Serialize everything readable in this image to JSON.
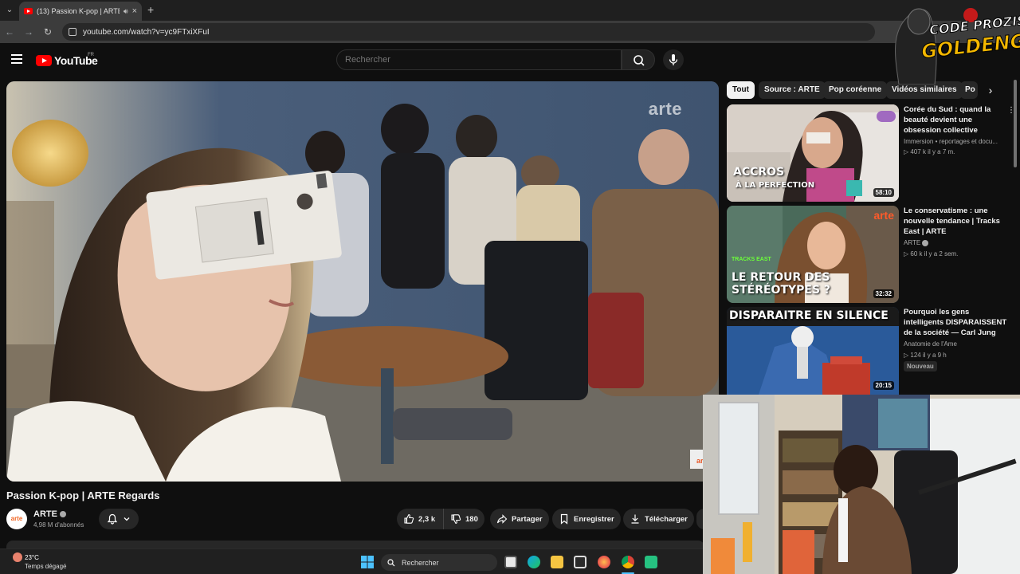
{
  "browser": {
    "tab_title": "(13) Passion K-pop | ARTE R",
    "url": "youtube.com/watch?v=yc9FTxiXFuI"
  },
  "youtube": {
    "logo_text": "YouTube",
    "region": "FR",
    "search_placeholder": "Rechercher"
  },
  "player": {
    "watermark": "arte"
  },
  "chips": [
    "Tout",
    "Source : ARTE",
    "Pop coréenne",
    "Vidéos similaires",
    "Po"
  ],
  "related": [
    {
      "title": "Corée du Sud : quand la beauté devient une obsession collective",
      "channel": "Immersion • reportages et docu...",
      "meta": "407 k  il y a 7 m.",
      "duration": "58:10",
      "thumb_text": [
        "ACCROS",
        "À LA PERFECTION"
      ]
    },
    {
      "title": "Le conservatisme : une nouvelle tendance | Tracks East | ARTE",
      "channel": "ARTE",
      "meta": "60 k  il y a 2 sem.",
      "duration": "32:32",
      "thumb_text": [
        "TRACKS EAST",
        "LE RETOUR DES",
        "STÉRÉOTYPES ?"
      ],
      "thumb_logo": "arte"
    },
    {
      "title": "Pourquoi les gens intelligents DISPARAISSENT de la société — Carl Jung",
      "channel": "Anatomie de l'Ame",
      "meta": "124  il y a 9 h",
      "badge": "Nouveau",
      "duration": "20:15",
      "thumb_text": [
        "DISPARAITRE EN SILENCE"
      ]
    }
  ],
  "video": {
    "title": "Passion K-pop | ARTE Regards",
    "channel": "ARTE",
    "avatar_text": "arte",
    "subscribers": "4,98 M d'abonnés",
    "likes": "2,3 k",
    "dislikes": "180",
    "share": "Partager",
    "save": "Enregistrer",
    "download": "Télécharger"
  },
  "taskbar": {
    "temperature": "23°C",
    "weather": "Temps dégagé",
    "search": "Rechercher"
  },
  "stream_logo": {
    "line1": "CODE PROZIS",
    "line2": "GOLDENG"
  },
  "colors": {
    "yt_red": "#ff0000",
    "background": "#0f0f0f",
    "chip": "#272727",
    "logo_gold": "#f5b800"
  }
}
